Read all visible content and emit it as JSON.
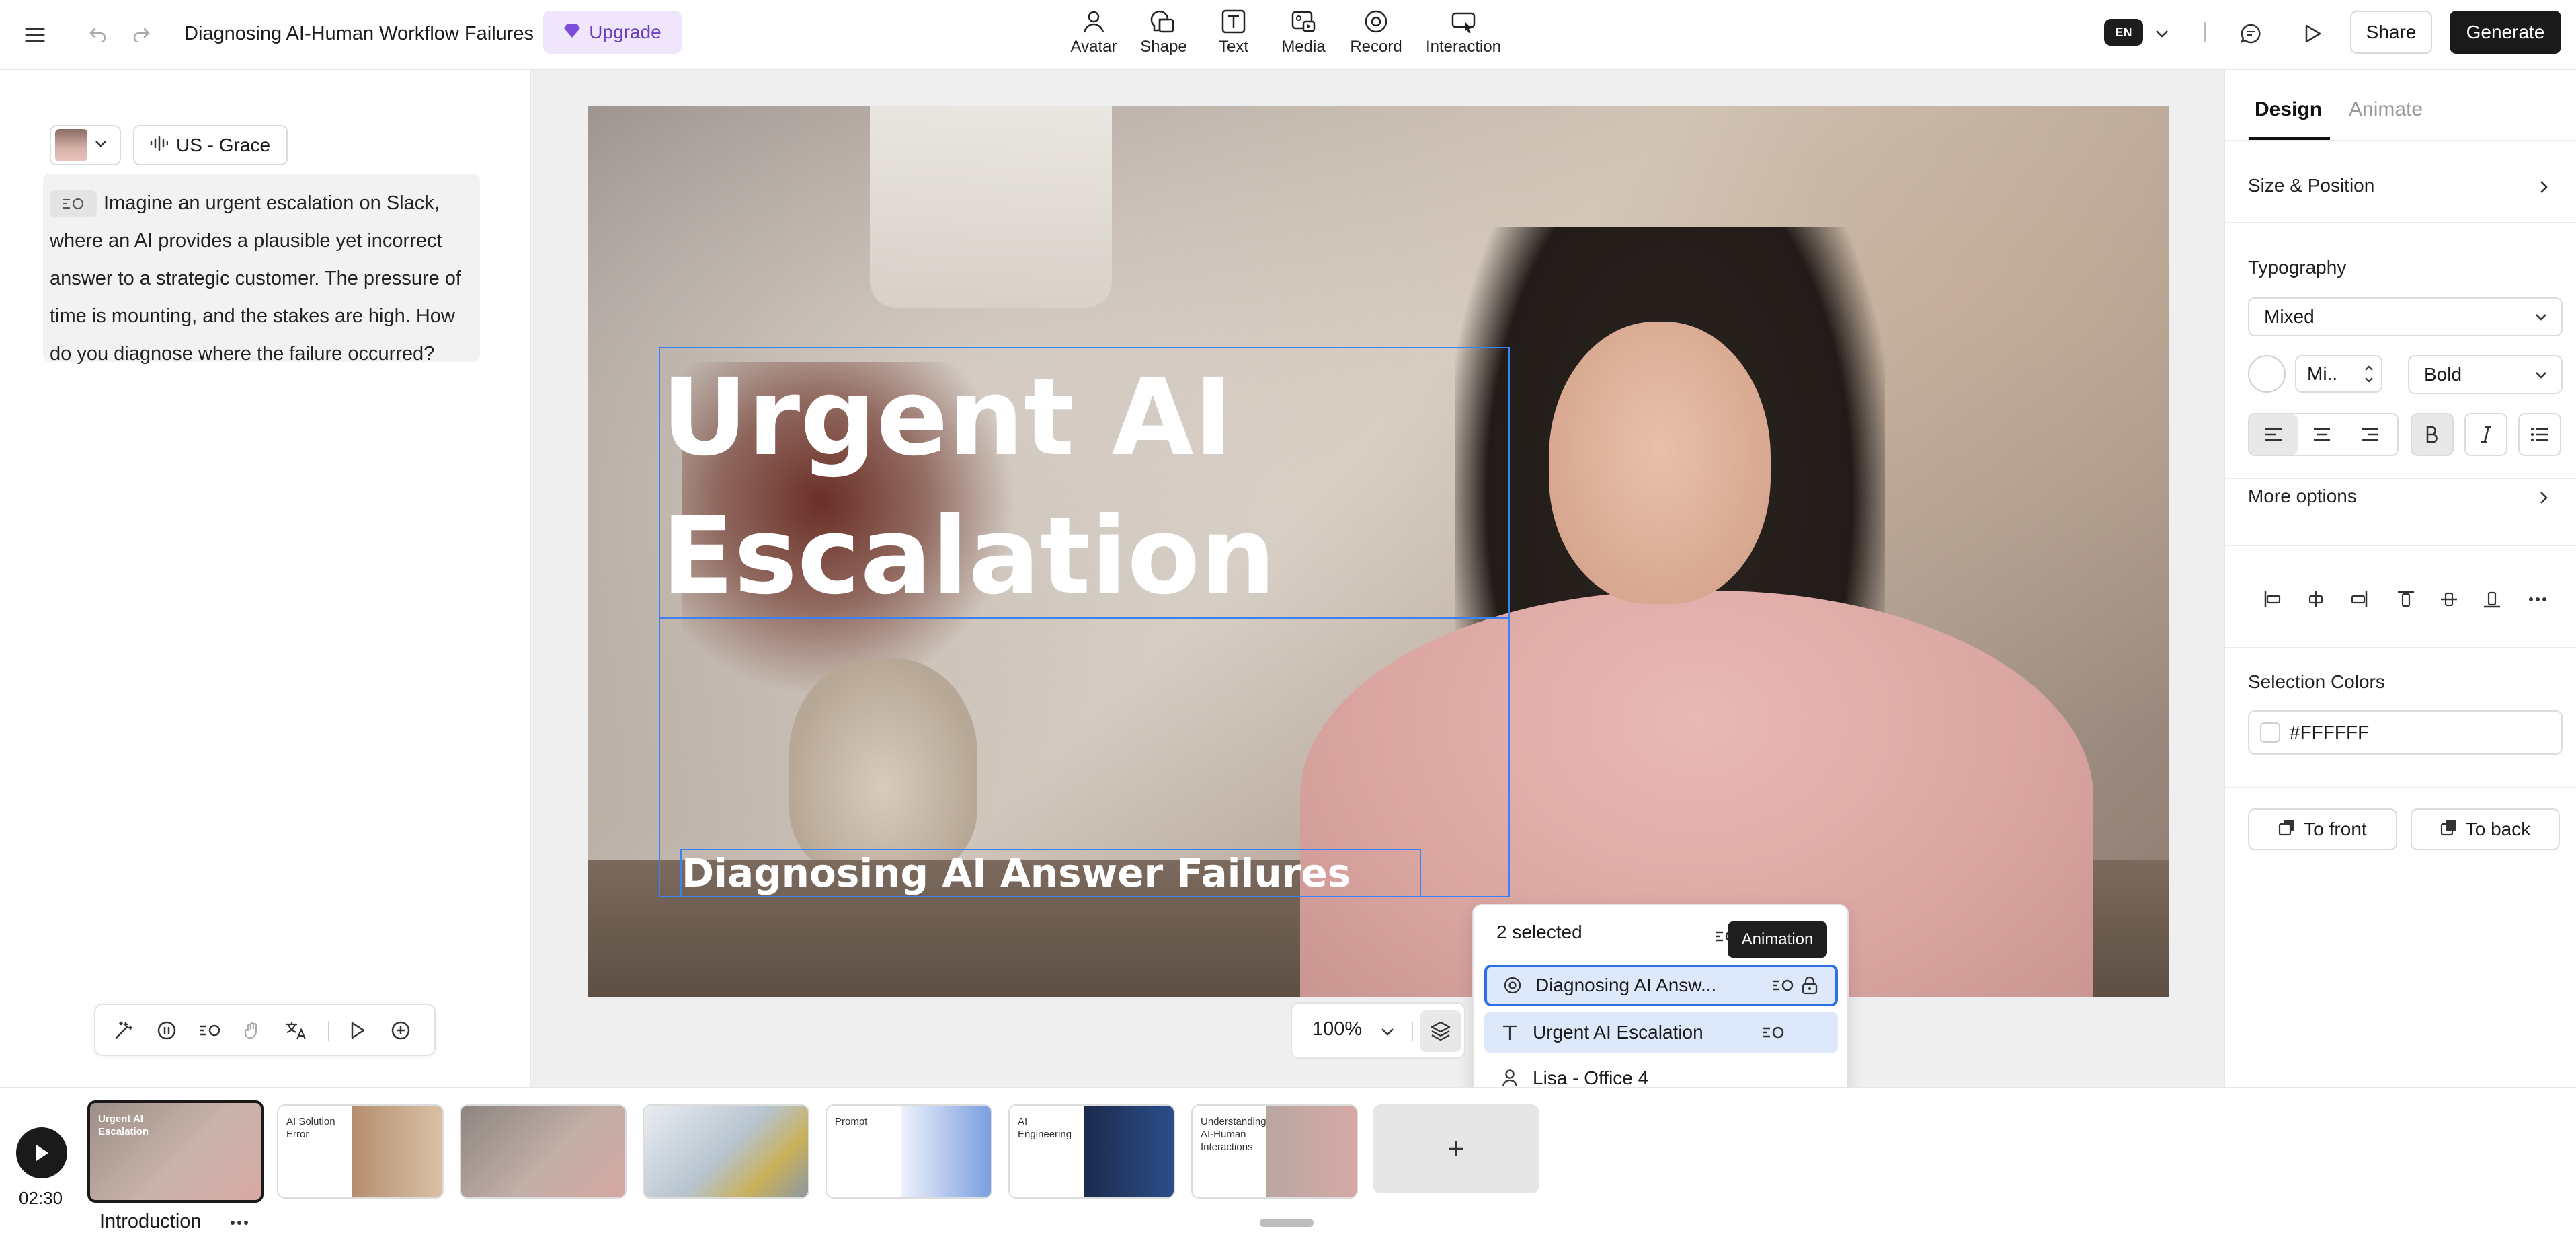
{
  "header": {
    "doc_title": "Diagnosing AI-Human Workflow Failures",
    "upgrade_label": "Upgrade",
    "tools": [
      {
        "label": "Avatar",
        "icon": "avatar-icon"
      },
      {
        "label": "Shape",
        "icon": "shape-icon"
      },
      {
        "label": "Text",
        "icon": "text-icon"
      },
      {
        "label": "Media",
        "icon": "media-icon"
      },
      {
        "label": "Record",
        "icon": "record-icon"
      },
      {
        "label": "Interaction",
        "icon": "interaction-icon"
      }
    ],
    "language": "EN",
    "share_label": "Share",
    "generate_label": "Generate"
  },
  "script_panel": {
    "voice_label": "US - Grace",
    "script_text": "Imagine an urgent escalation on Slack, where an AI provides a plausible yet incorrect answer to a strategic customer. The pressure of time is mounting, and the stakes are high. How do you diagnose where the failure occurred?"
  },
  "canvas": {
    "headline": "Urgent AI Escalation",
    "subtitle": "Diagnosing AI Answer Failures",
    "zoom": "100%"
  },
  "layers": {
    "selected_count": "2 selected",
    "tooltip": "Animation",
    "items": [
      {
        "name": "Diagnosing AI Answ...",
        "icon": "target-icon"
      },
      {
        "name": "Urgent AI Escalation",
        "icon": "text-t-icon"
      },
      {
        "name": "Lisa - Office 4",
        "icon": "person-icon"
      }
    ]
  },
  "design_panel": {
    "tab_design": "Design",
    "tab_animate": "Animate",
    "size_position": "Size & Position",
    "typography": "Typography",
    "font_family_value": "Mixed",
    "font_size_value": "Mi..",
    "font_weight_value": "Bold",
    "more_options": "More options",
    "selection_colors": "Selection Colors",
    "color_hex": "#FFFFFF",
    "to_front": "To front",
    "to_back": "To back"
  },
  "timeline": {
    "duration": "02:30",
    "scene_name": "Introduction",
    "thumbnails": [
      {
        "text": "Urgent AI Escalation"
      },
      {
        "text": "AI Solution Error"
      },
      {
        "text": ""
      },
      {
        "text": ""
      },
      {
        "text": "Prompt"
      },
      {
        "text": "AI Engineering"
      },
      {
        "text": "Understanding AI-Human Interactions"
      }
    ]
  },
  "colors": {
    "accent_blue": "#3b82f6",
    "upgrade_purple": "#6b3fbf",
    "primary_dark": "#1a1a1a"
  }
}
